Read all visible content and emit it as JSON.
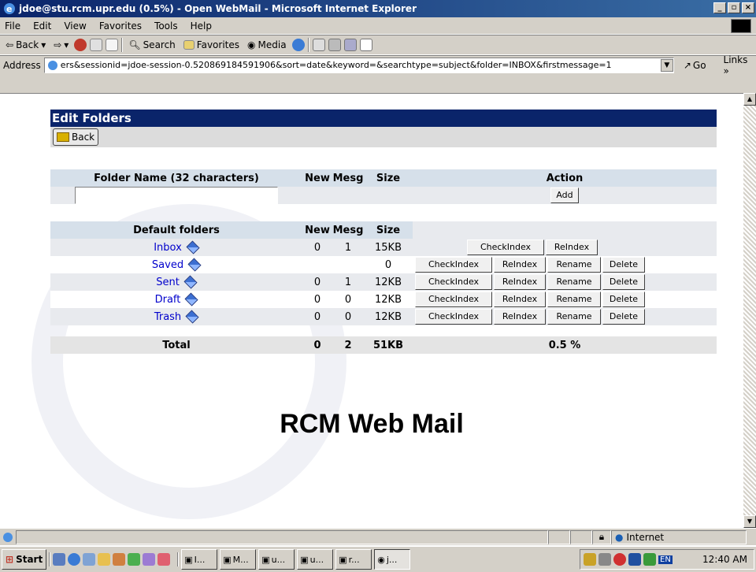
{
  "window": {
    "title": "jdoe@stu.rcm.upr.edu (0.5%) - Open WebMail - Microsoft Internet Explorer",
    "btn_minimize": "_",
    "btn_maximize": "▫",
    "btn_close": "×"
  },
  "menu": [
    "File",
    "Edit",
    "View",
    "Favorites",
    "Tools",
    "Help"
  ],
  "toolbar": {
    "back": "Back",
    "search": "Search",
    "favorites": "Favorites",
    "media": "Media"
  },
  "address": {
    "label": "Address",
    "url": "ers&sessionid=jdoe-session-0.520869184591906&sort=date&keyword=&searchtype=subject&folder=INBOX&firstmessage=1",
    "go": "Go",
    "links": "Links »"
  },
  "page": {
    "heading": "Edit Folders",
    "back_button": "Back",
    "new_folder": {
      "col_name": "Folder Name (32 characters)",
      "col_new": "New",
      "col_mesg": "Mesg",
      "col_size": "Size",
      "col_action": "Action",
      "input_value": "",
      "add_button": "Add"
    },
    "default_folders": {
      "col_name": "Default folders",
      "col_new": "New",
      "col_mesg": "Mesg",
      "col_size": "Size",
      "rows": [
        {
          "name": "Inbox",
          "new": "0",
          "mesg": "1",
          "size": "15KB",
          "actions": [
            "CheckIndex",
            "ReIndex"
          ]
        },
        {
          "name": "Saved",
          "new": "",
          "mesg": "",
          "size": "0",
          "actions": [
            "CheckIndex",
            "ReIndex",
            "Rename",
            "Delete"
          ]
        },
        {
          "name": "Sent",
          "new": "0",
          "mesg": "1",
          "size": "12KB",
          "actions": [
            "CheckIndex",
            "ReIndex",
            "Rename",
            "Delete"
          ]
        },
        {
          "name": "Draft",
          "new": "0",
          "mesg": "0",
          "size": "12KB",
          "actions": [
            "CheckIndex",
            "ReIndex",
            "Rename",
            "Delete"
          ]
        },
        {
          "name": "Trash",
          "new": "0",
          "mesg": "0",
          "size": "12KB",
          "actions": [
            "CheckIndex",
            "ReIndex",
            "Rename",
            "Delete"
          ]
        }
      ]
    },
    "total": {
      "label": "Total",
      "new": "0",
      "mesg": "2",
      "size": "51KB",
      "usage": "0.5 %"
    },
    "brand": "RCM Web Mail"
  },
  "statusbar": {
    "zone": "Internet"
  },
  "taskbar": {
    "start": "Start",
    "tasks": [
      "I...",
      "M...",
      "u...",
      "u...",
      "r...",
      "j..."
    ],
    "tray_lang": "EN",
    "clock": "12:40 AM"
  },
  "colors": {
    "header_bg": "#0a246a",
    "link": "#0000cc",
    "col_header_bg": "#d6e0ea"
  }
}
